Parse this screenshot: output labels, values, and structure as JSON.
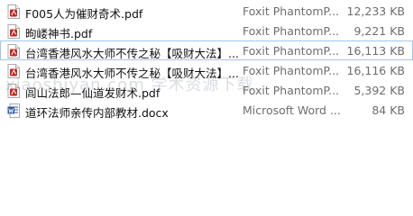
{
  "files": [
    {
      "name": "F005人为催财奇术.pdf",
      "type": "Foxit PhantomP...",
      "size": "12,233 KB",
      "icon": "pdf-icon"
    },
    {
      "name": "昫嵝神书.pdf",
      "type": "Foxit PhantomP...",
      "size": "9,221 KB",
      "icon": "pdf-icon"
    },
    {
      "name": "台湾香港风水大师不传之秘【吸财大法】...",
      "type": "Foxit PhantomP...",
      "size": "16,113 KB",
      "icon": "pdf-icon",
      "selected": true
    },
    {
      "name": "台湾香港风水大师不传之秘【吸财大法】...",
      "type": "Foxit PhantomP...",
      "size": "16,116 KB",
      "icon": "pdf-icon"
    },
    {
      "name": "闾山法郎—仙道发财术.pdf",
      "type": "Foxit PhantomP...",
      "size": "5,392 KB",
      "icon": "pdf-icon"
    },
    {
      "name": "道环法师亲传内部教材.docx",
      "type": "Microsoft Word ...",
      "size": "84 KB",
      "icon": "docx-icon"
    }
  ],
  "watermark": "xiaoshiyan.com 学术资源下载",
  "colors": {
    "pdf_accent": "#c2271f",
    "word_accent": "#2b579a",
    "selection_border": "#9fc6ec"
  }
}
